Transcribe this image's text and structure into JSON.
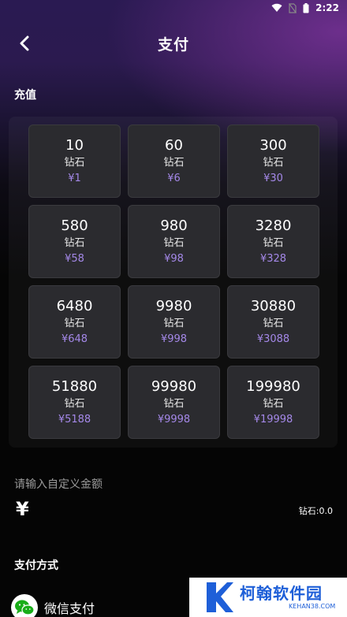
{
  "status_bar": {
    "time": "2:22"
  },
  "header": {
    "title": "支付"
  },
  "recharge": {
    "section_title": "充值",
    "packages": [
      {
        "diamonds": "10",
        "unit": "钻石",
        "price": "¥1"
      },
      {
        "diamonds": "60",
        "unit": "钻石",
        "price": "¥6"
      },
      {
        "diamonds": "300",
        "unit": "钻石",
        "price": "¥30"
      },
      {
        "diamonds": "580",
        "unit": "钻石",
        "price": "¥58"
      },
      {
        "diamonds": "980",
        "unit": "钻石",
        "price": "¥98"
      },
      {
        "diamonds": "3280",
        "unit": "钻石",
        "price": "¥328"
      },
      {
        "diamonds": "6480",
        "unit": "钻石",
        "price": "¥648"
      },
      {
        "diamonds": "9980",
        "unit": "钻石",
        "price": "¥998"
      },
      {
        "diamonds": "30880",
        "unit": "钻石",
        "price": "¥3088"
      },
      {
        "diamonds": "51880",
        "unit": "钻石",
        "price": "¥5188"
      },
      {
        "diamonds": "99980",
        "unit": "钻石",
        "price": "¥9998"
      },
      {
        "diamonds": "199980",
        "unit": "钻石",
        "price": "¥19998"
      }
    ]
  },
  "custom_amount": {
    "label": "请输入自定义金额",
    "currency_symbol": "¥",
    "value": "",
    "diamond_readout": "钻石:0.0"
  },
  "payment": {
    "section_title": "支付方式",
    "methods": [
      {
        "label": "微信支付",
        "icon": "wechat-icon"
      }
    ]
  },
  "watermark": {
    "name": "柯翰软件园",
    "site": "KEHAN38.COM"
  },
  "colors": {
    "price_accent": "#a488e8",
    "card_bg": "#2b2b2f",
    "wechat_green": "#1aad19",
    "watermark_blue": "#1e5fd8"
  }
}
